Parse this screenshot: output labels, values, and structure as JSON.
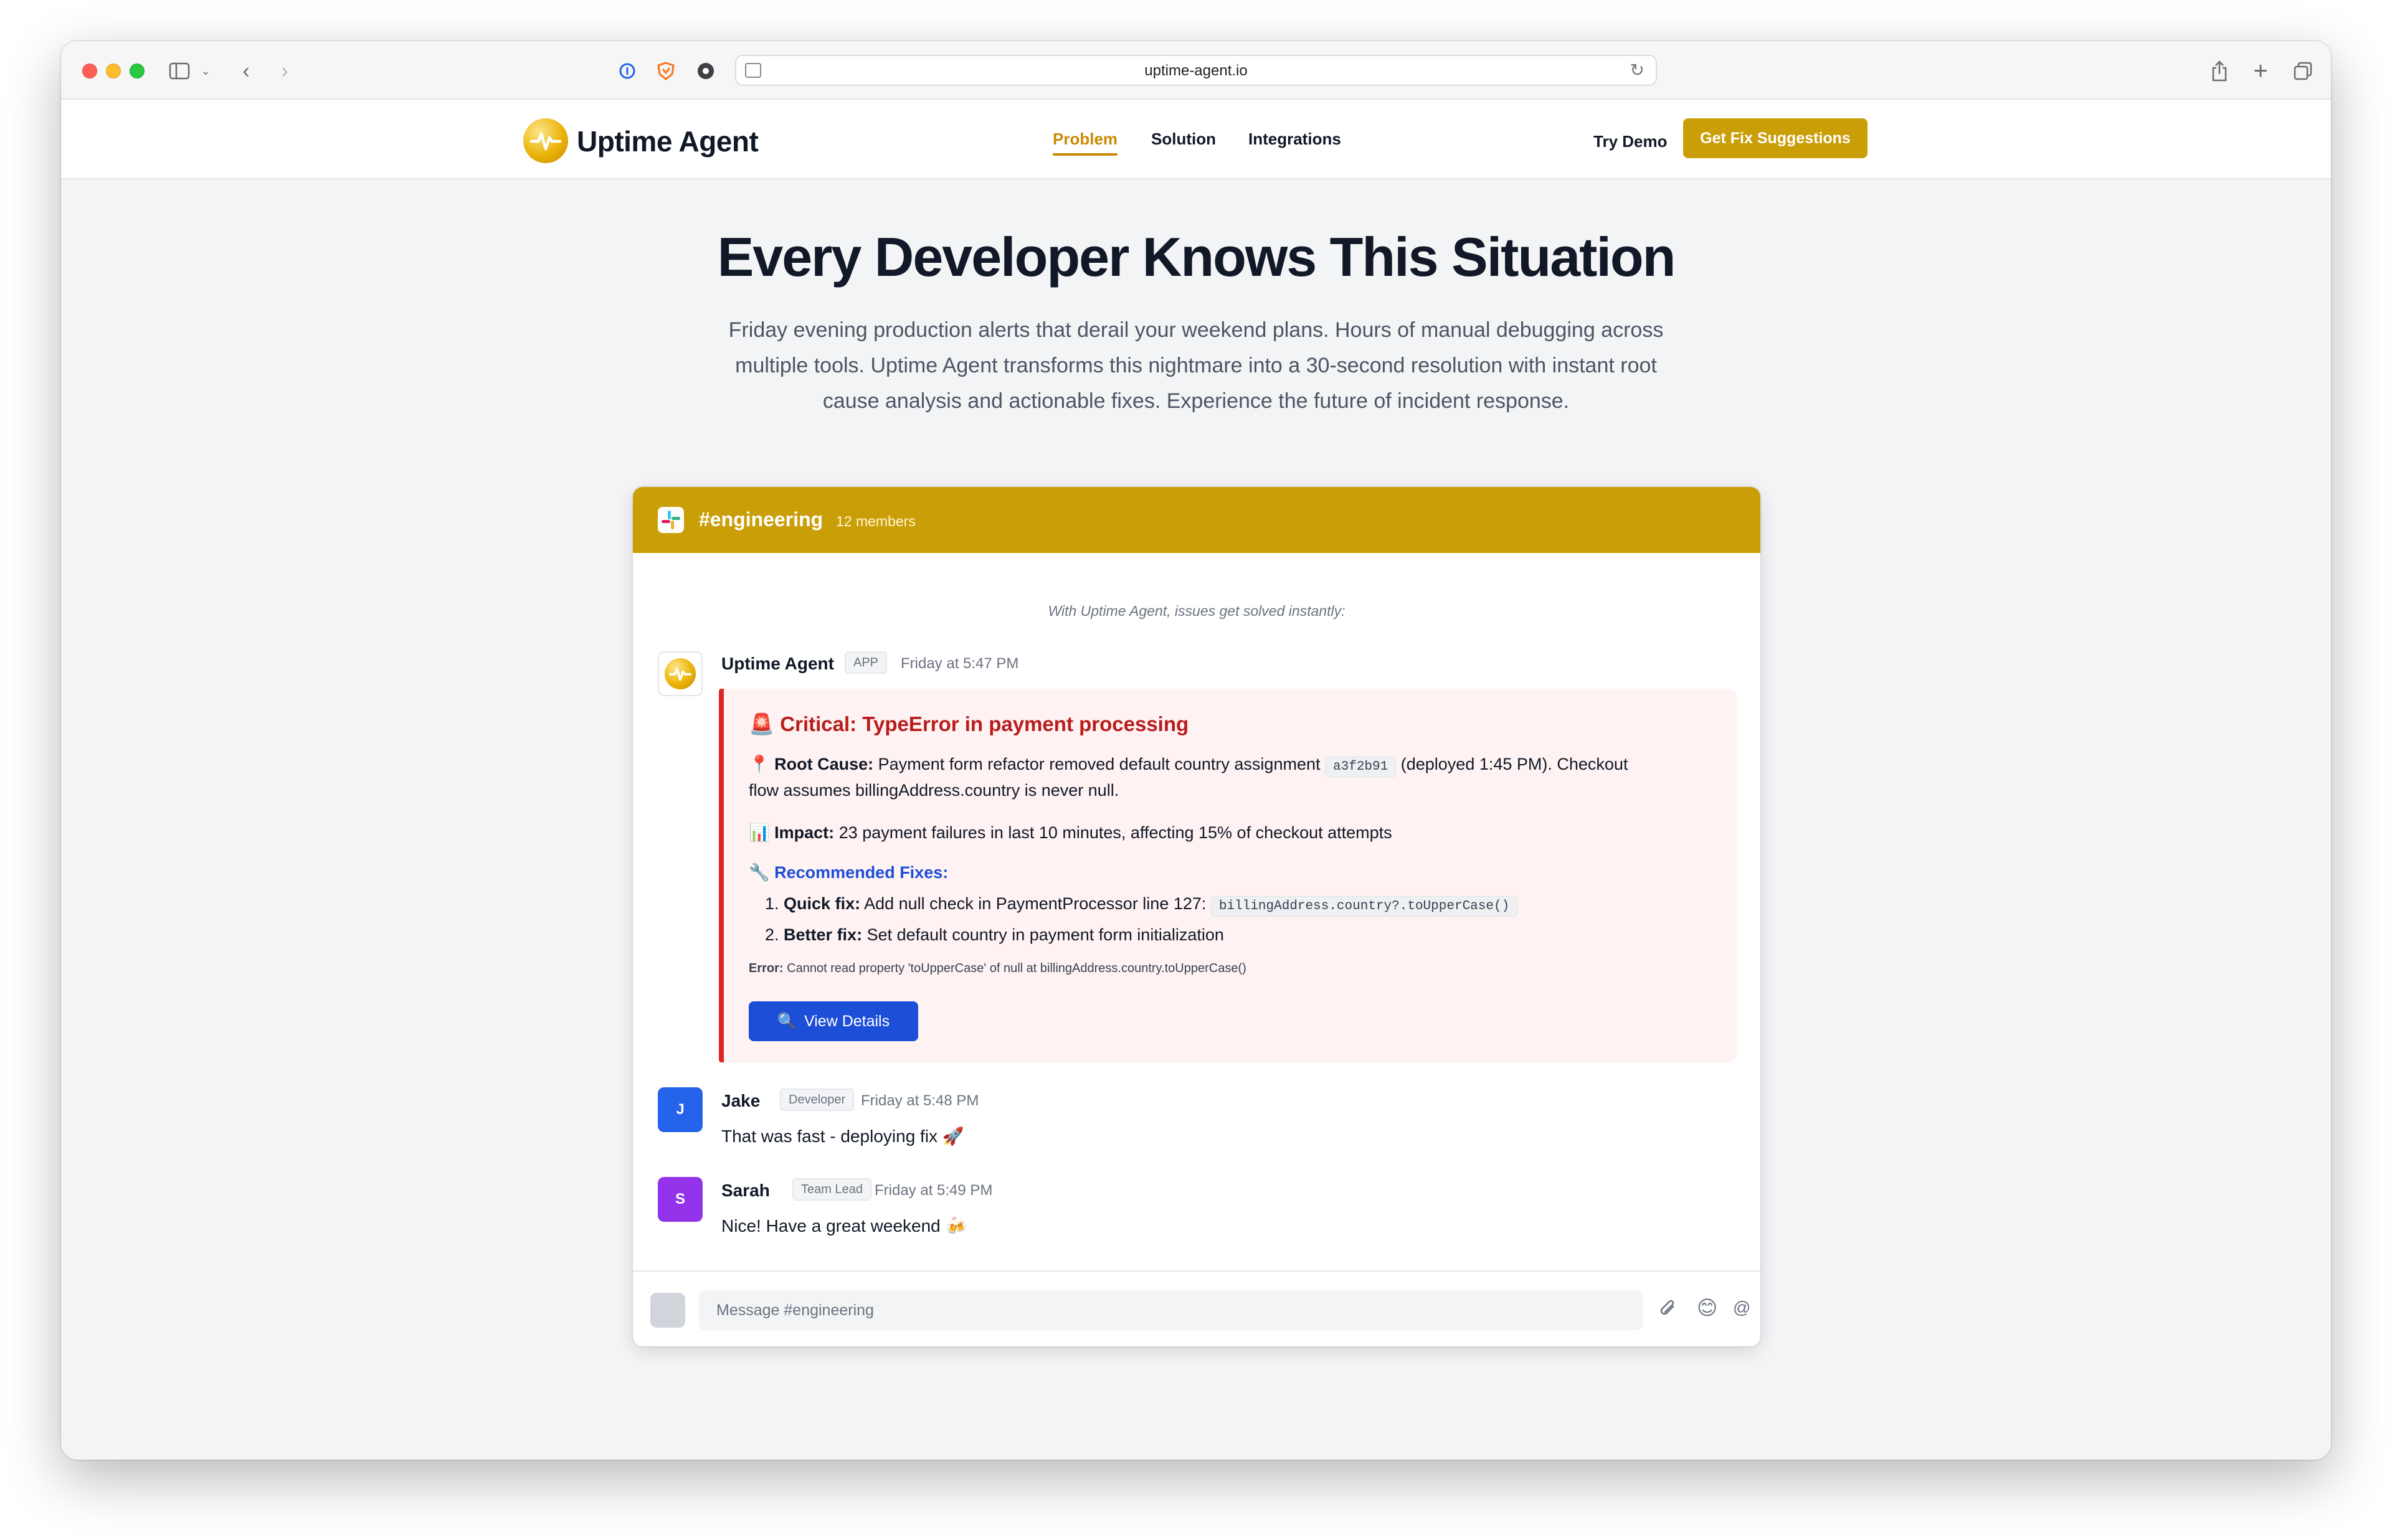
{
  "browser": {
    "url": "uptime-agent.io"
  },
  "nav": {
    "brand": "Uptime Agent",
    "links": [
      "Problem",
      "Solution",
      "Integrations"
    ],
    "active": "Problem",
    "try_demo": "Try Demo",
    "cta": "Get Fix Suggestions"
  },
  "hero": {
    "title": "Every Developer Knows This Situation",
    "line1": "Friday evening production alerts that derail your weekend plans. Hours of manual debugging across",
    "line2": "multiple tools. Uptime Agent transforms this nightmare into a 30-second resolution with instant root",
    "line3": "cause analysis and actionable fixes. Experience the future of incident response."
  },
  "chat": {
    "channel": "#engineering",
    "members": "12 members",
    "intro": "With Uptime Agent, issues get solved instantly:",
    "bot": {
      "name": "Uptime Agent",
      "tag": "APP",
      "time": "Friday at 5:47 PM"
    },
    "alert": {
      "title": "Critical: TypeError in payment processing",
      "root_label": "Root Cause:",
      "root_text_1": "Payment form refactor removed default country assignment",
      "commit": "a3f2b91",
      "root_text_2": "(deployed 1:45 PM). Checkout",
      "root_text_3": "flow assumes billingAddress.country is never null.",
      "impact_label": "Impact:",
      "impact_text": "23 payment failures in last 10 minutes, affecting 15% of checkout attempts",
      "fixes_label": "Recommended Fixes:",
      "fix1_num": "1.",
      "fix1_label": "Quick fix:",
      "fix1_text": "Add null check in PaymentProcessor line 127:",
      "fix1_code": "billingAddress.country?.toUpperCase()",
      "fix2_num": "2.",
      "fix2_label": "Better fix:",
      "fix2_text": "Set default country in payment form initialization",
      "error_label": "Error:",
      "error_text": "Cannot read property 'toUpperCase' of null at billingAddress.country.toUpperCase()",
      "button": "View Details"
    },
    "messages": [
      {
        "initial": "J",
        "name": "Jake",
        "tag": "Developer",
        "time": "Friday at 5:48 PM",
        "text": "That was fast - deploying fix 🚀"
      },
      {
        "initial": "S",
        "name": "Sarah",
        "tag": "Team Lead",
        "time": "Friday at 5:49 PM",
        "text": "Nice! Have a great weekend 🍻"
      }
    ],
    "composer_placeholder": "Message #engineering"
  },
  "colors": {
    "brand": "#ca9e07",
    "critical": "#dc2626",
    "link_blue": "#1d4ed8",
    "jake": "#2563eb",
    "sarah": "#9333ea"
  }
}
